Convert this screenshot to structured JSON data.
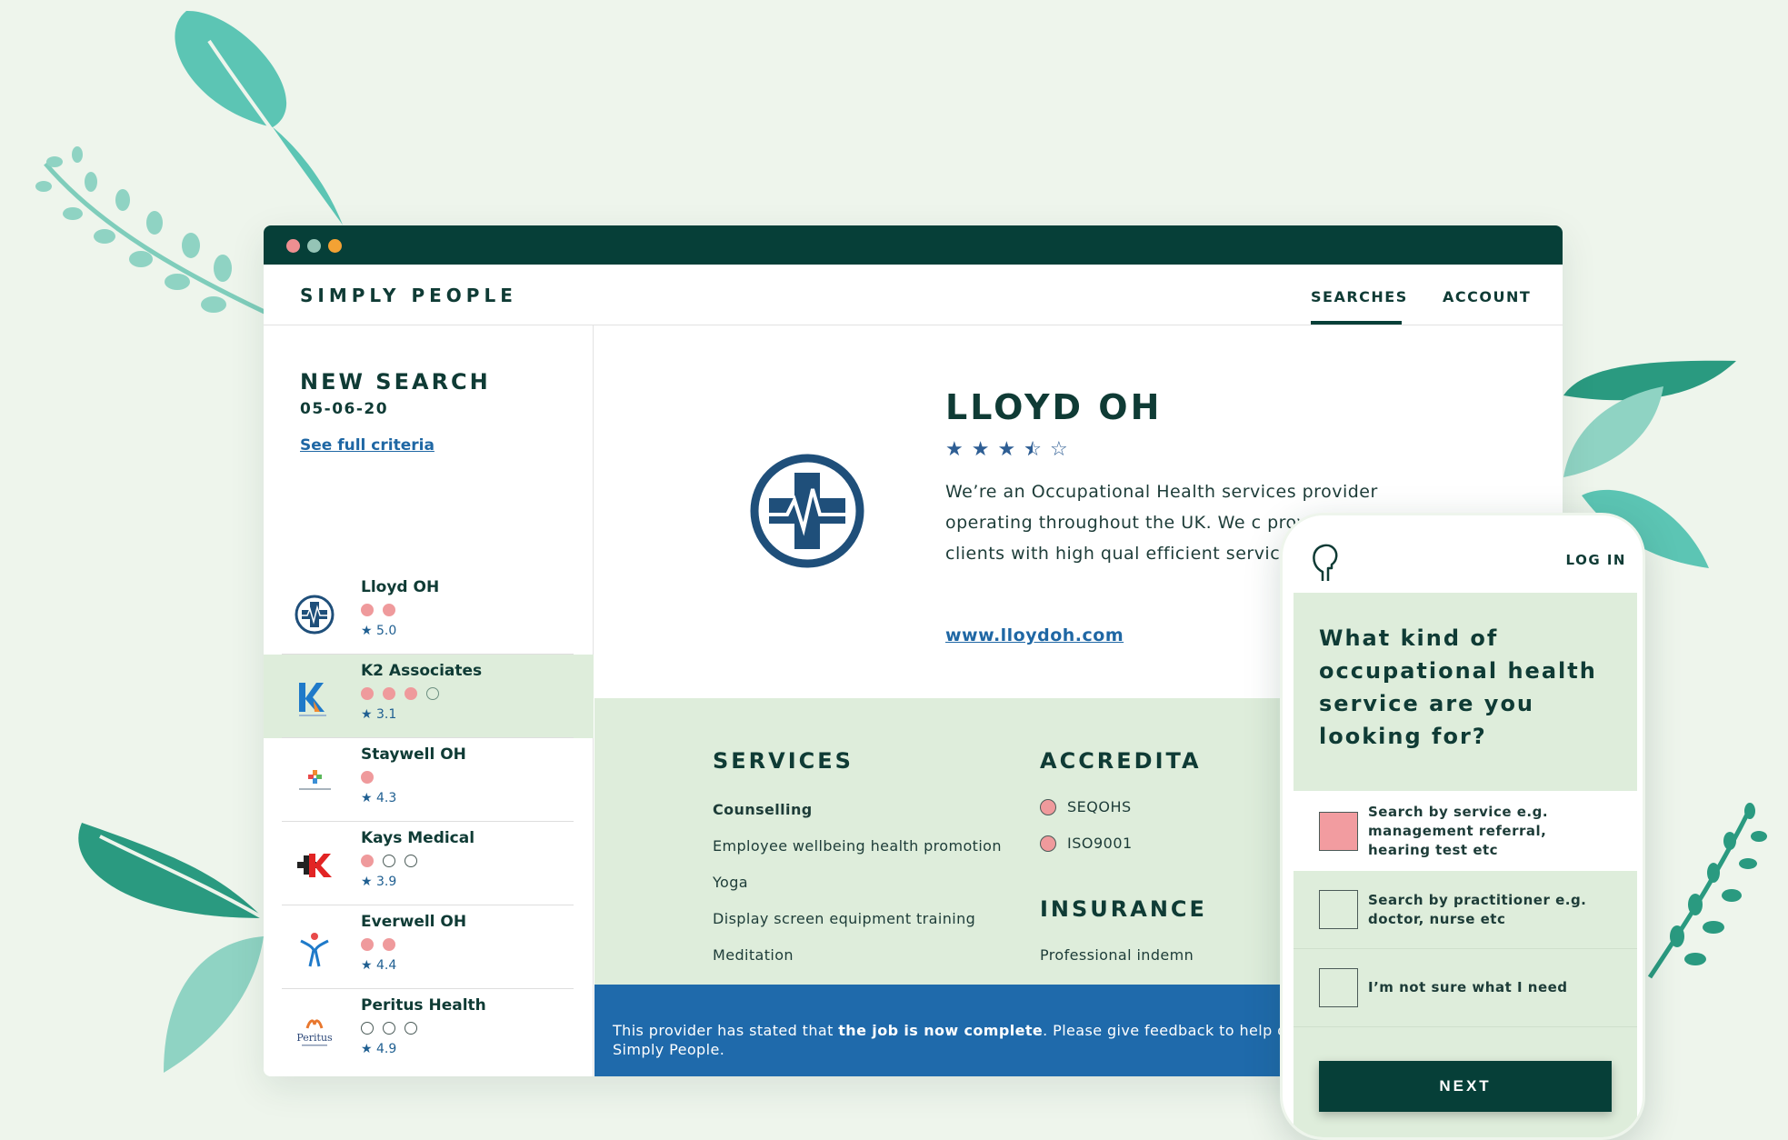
{
  "colors": {
    "background": "#eef5ec",
    "dark_green": "#063f38",
    "light_green": "#deeddb",
    "accent_pink": "#ef9a9c",
    "link_blue": "#1f67a4",
    "banner_blue": "#1f6aab",
    "leaf_teal": "#5cc5b4"
  },
  "app": {
    "brand": "SIMPLY PEOPLE",
    "nav": {
      "searches": "SEARCHES",
      "account": "ACCOUNT",
      "active": "searches"
    }
  },
  "sidebar": {
    "title": "NEW SEARCH",
    "date": "05-06-20",
    "criteria_link": "See full criteria",
    "providers": [
      {
        "name": "Lloyd OH",
        "filled": 2,
        "empty": 0,
        "rating": "5.0",
        "logo": "lloyd-oh-logo",
        "active": false
      },
      {
        "name": "K2 Associates",
        "filled": 3,
        "empty": 1,
        "rating": "3.1",
        "logo": "k2-associates-logo",
        "active": true
      },
      {
        "name": "Staywell OH",
        "filled": 1,
        "empty": 0,
        "rating": "4.3",
        "logo": "staywell-logo",
        "active": false
      },
      {
        "name": "Kays Medical",
        "filled": 1,
        "empty": 2,
        "rating": "3.9",
        "logo": "kays-medical-logo",
        "active": false
      },
      {
        "name": "Everwell OH",
        "filled": 2,
        "empty": 0,
        "rating": "4.4",
        "logo": "everwell-logo",
        "active": false
      },
      {
        "name": "Peritus Health",
        "filled": 0,
        "empty": 3,
        "rating": "4.9",
        "logo": "peritus-logo",
        "active": false
      }
    ]
  },
  "provider": {
    "name": "LLOYD OH",
    "stars": 3.5,
    "description": "We’re an Occupational Health services provider operating throughout the UK. We c provide our clients with high qual efficient services.",
    "website": "www.lloydoh.com",
    "services_title": "SERVICES",
    "services": [
      "Counselling",
      "Employee wellbeing health promotion",
      "Yoga",
      "Display screen equipment training",
      "Meditation"
    ],
    "accreditations_title": "ACCREDITA",
    "accreditations": [
      "SEQOHS",
      "ISO9001"
    ],
    "insurance_title": "INSURANCE",
    "insurance": [
      "Professional indemn"
    ]
  },
  "banner": {
    "text_before": "This provider has stated that ",
    "text_bold": "the job is now complete",
    "text_after": ". Please give feedback to help others find their ideal provider on Simply People."
  },
  "phone": {
    "login": "LOG IN",
    "question": "What kind of occupational health service are you looking for?",
    "options": [
      {
        "label": "Search by service e.g. management referral, hearing test etc",
        "selected": true
      },
      {
        "label": "Search by practitioner e.g. doctor, nurse etc",
        "selected": false
      },
      {
        "label": "I’m not sure what I need",
        "selected": false
      }
    ],
    "next": "NEXT"
  }
}
